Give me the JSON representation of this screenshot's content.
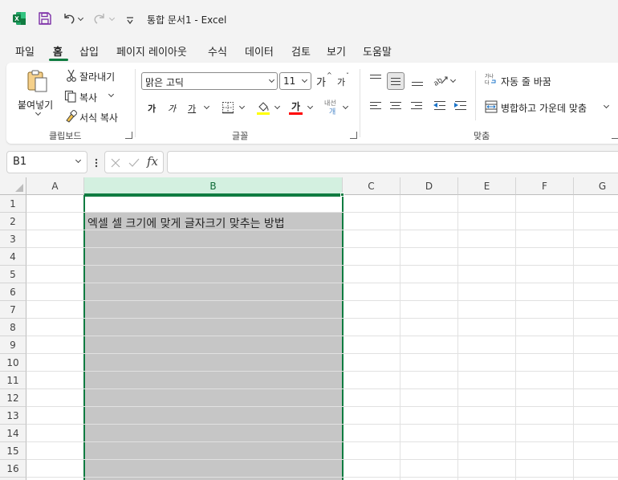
{
  "titlebar": {
    "doc_title": "통합 문서1  -  Excel",
    "icons": [
      "excel-logo-icon",
      "save-icon",
      "undo-icon",
      "redo-icon",
      "customize-qat-icon"
    ]
  },
  "menu": {
    "items": [
      "파일",
      "홈",
      "삽입",
      "페이지 레이아웃",
      "수식",
      "데이터",
      "검토",
      "보기",
      "도움말"
    ],
    "active": "홈"
  },
  "ribbon": {
    "clipboard": {
      "paste": "붙여넣기",
      "cut": "잘라내기",
      "copy": "복사",
      "format_painter": "서식 복사",
      "label": "클립보드"
    },
    "font": {
      "font_name": "맑은 고딕",
      "font_size": "11",
      "grow": "가",
      "shrink": "가",
      "bold": "가",
      "italic": "가",
      "underline": "가",
      "font_color": "가",
      "phonetic": "내선",
      "label": "글꼴",
      "fill_color": "#ffff00",
      "text_color": "#ff0000"
    },
    "alignment": {
      "wrap_text": "자동 줄 바꿈",
      "merge_center": "병합하고 가운데 맞춤",
      "label": "맞춤",
      "orientation_icon": "orientation-icon"
    }
  },
  "formula_bar": {
    "name_box": "B1",
    "fx": "fx",
    "formula": ""
  },
  "grid": {
    "columns": [
      "A",
      "B",
      "C",
      "D",
      "E",
      "F",
      "G"
    ],
    "rows": [
      "1",
      "2",
      "3",
      "4",
      "5",
      "6",
      "7",
      "8",
      "9",
      "10",
      "11",
      "12",
      "13",
      "14",
      "15",
      "16"
    ],
    "selected_column": "B",
    "selection_fill": "#c6c6c6",
    "accent": "#107c41",
    "cells": {
      "B2": "엑셀 셀 크기에 맞게 글자크기 맞추는 방법"
    }
  }
}
